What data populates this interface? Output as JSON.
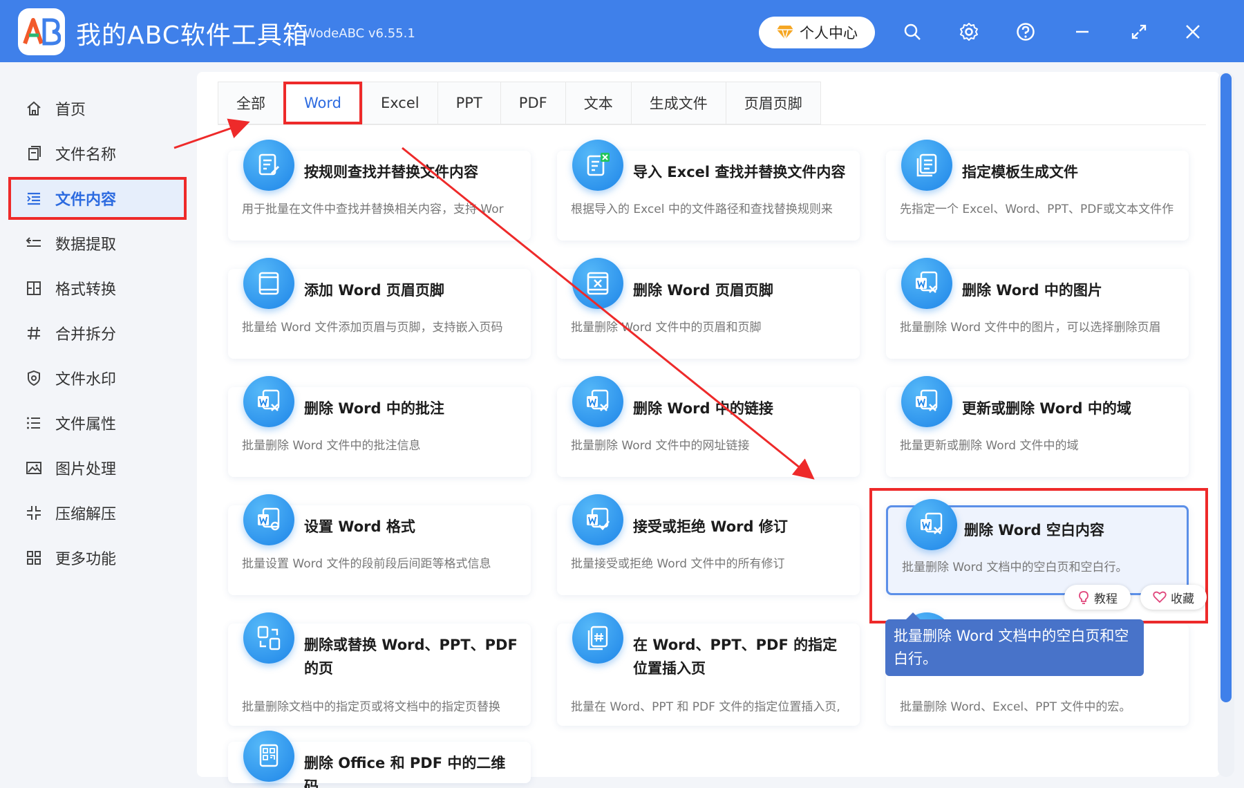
{
  "app": {
    "title": "我的ABC软件工具箱",
    "version": "WodeABC v6.55.1",
    "logo_text": "AB",
    "user_center": "个人中心"
  },
  "sidebar": {
    "items": [
      {
        "label": "首页",
        "icon": "home-icon"
      },
      {
        "label": "文件名称",
        "icon": "file-name-icon"
      },
      {
        "label": "文件内容",
        "icon": "file-content-icon",
        "active": true
      },
      {
        "label": "数据提取",
        "icon": "data-extract-icon"
      },
      {
        "label": "格式转换",
        "icon": "format-convert-icon"
      },
      {
        "label": "合并拆分",
        "icon": "merge-split-icon"
      },
      {
        "label": "文件水印",
        "icon": "watermark-icon"
      },
      {
        "label": "文件属性",
        "icon": "file-properties-icon"
      },
      {
        "label": "图片处理",
        "icon": "image-icon"
      },
      {
        "label": "压缩解压",
        "icon": "compress-icon"
      },
      {
        "label": "更多功能",
        "icon": "more-icon"
      }
    ]
  },
  "tabs": [
    {
      "label": "全部"
    },
    {
      "label": "Word",
      "active": true
    },
    {
      "label": "Excel"
    },
    {
      "label": "PPT"
    },
    {
      "label": "PDF"
    },
    {
      "label": "文本"
    },
    {
      "label": "生成文件"
    },
    {
      "label": "页眉页脚"
    }
  ],
  "cards": [
    {
      "title": "按规则查找并替换文件内容",
      "desc": "用于批量在文件中查找并替换相关内容，支持 Wor"
    },
    {
      "title": "导入 Excel 查找并替换文件内容",
      "desc": "根据导入的 Excel 中的文件路径和查找替换规则来"
    },
    {
      "title": "指定模板生成文件",
      "desc": "先指定一个 Excel、Word、PPT、PDF或文本文件作"
    },
    {
      "title": "添加 Word 页眉页脚",
      "desc": "批量给 Word 文件添加页眉与页脚，支持嵌入页码"
    },
    {
      "title": "删除 Word 页眉页脚",
      "desc": "批量删除 Word 文件中的页眉和页脚"
    },
    {
      "title": "删除 Word 中的图片",
      "desc": "批量删除 Word 文件中的图片，可以选择删除页眉"
    },
    {
      "title": "删除 Word 中的批注",
      "desc": "批量删除 Word 文件中的批注信息"
    },
    {
      "title": "删除 Word 中的链接",
      "desc": "批量删除 Word 文件中的网址链接"
    },
    {
      "title": "更新或删除 Word 中的域",
      "desc": "批量更新或删除 Word 文件中的域"
    },
    {
      "title": "设置 Word 格式",
      "desc": "批量设置 Word 文件的段前段后间距等格式信息"
    },
    {
      "title": "接受或拒绝 Word 修订",
      "desc": "批量接受或拒绝 Word 文件中的所有修订"
    },
    {
      "title": "删除 Word 空白内容",
      "desc": "批量删除 Word 文档中的空白页和空白行。"
    },
    {
      "title": "删除或替换 Word、PPT、PDF 的页",
      "desc": "批量删除文档中的指定页或将文档中的指定页替换"
    },
    {
      "title": "在 Word、PPT、PDF 的指定位置插入页",
      "desc": "批量在 Word、PPT 和 PDF 文件的指定位置插入页,"
    },
    {
      "title": "",
      "desc": "批量删除 Word、Excel、PPT 文件中的宏。"
    },
    {
      "title": "删除 Office 和 PDF 中的二维码",
      "desc": ""
    }
  ],
  "card_actions": {
    "tutorial": "教程",
    "favorite": "收藏"
  },
  "tooltip": {
    "text": "批量删除 Word 文档中的空白页和空白行。"
  },
  "colors": {
    "titlebar": "#3f80ea",
    "accent": "#2d6be0",
    "highlight": "#ee2a2a",
    "tooltip": "#4873c9"
  }
}
